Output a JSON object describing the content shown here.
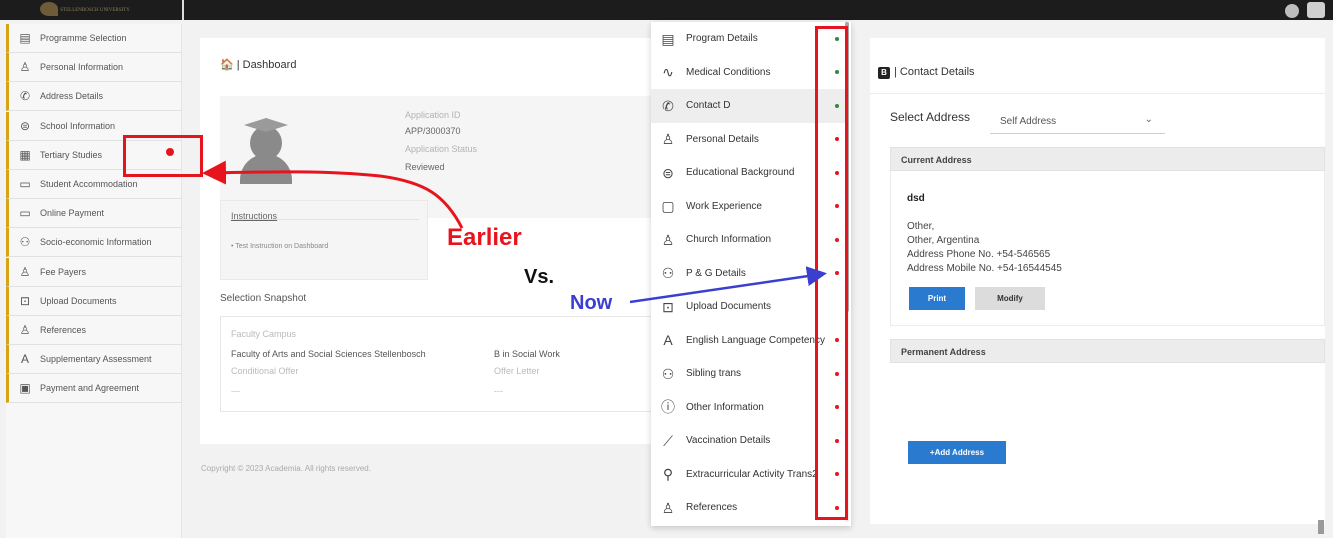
{
  "topbar": {
    "logo_text": "STELLENBOSCH UNIVERSITY"
  },
  "sidebar": {
    "items": [
      {
        "label": "Programme Selection",
        "icon": "document-icon"
      },
      {
        "label": "Personal Information",
        "icon": "person-list-icon"
      },
      {
        "label": "Address Details",
        "icon": "phone-icon"
      },
      {
        "label": "School Information",
        "icon": "graduation-cap-icon"
      },
      {
        "label": "Tertiary Studies",
        "icon": "building-icon"
      },
      {
        "label": "Student Accommodation",
        "icon": "bed-icon"
      },
      {
        "label": "Online Payment",
        "icon": "card-icon"
      },
      {
        "label": "Socio-economic Information",
        "icon": "people-icon"
      },
      {
        "label": "Fee Payers",
        "icon": "payer-icon"
      },
      {
        "label": "Upload Documents",
        "icon": "upload-folder-icon"
      },
      {
        "label": "References",
        "icon": "references-icon"
      },
      {
        "label": "Supplementary Assessment",
        "icon": "assessment-icon"
      },
      {
        "label": "Payment and Agreement",
        "icon": "agreement-icon"
      }
    ]
  },
  "dashboard": {
    "title": "Dashboard",
    "application_id_label": "Application ID",
    "application_id": "APP/3000370",
    "application_status_label": "Application Status",
    "application_status": "Reviewed",
    "instructions_title": "Instructions",
    "instruction_item": "Test Instruction on Dashboard",
    "snapshot_title": "Selection Snapshot",
    "faculty_campus_label": "Faculty Campus",
    "faculty_campus": "Faculty of Arts and Social Sciences Stellenbosch",
    "programme": "B in Social Work",
    "conditional_offer_label": "Conditional Offer",
    "conditional_offer": "---",
    "offer_letter_label": "Offer Letter",
    "offer_letter": "---",
    "copyright": "Copyright © 2023 Academia. All rights reserved."
  },
  "annotations": {
    "earlier": "Earlier",
    "vs": "Vs.",
    "now": "Now"
  },
  "menu": {
    "items": [
      {
        "label": "Program Details",
        "icon": "document-icon",
        "status": "green"
      },
      {
        "label": "Medical Conditions",
        "icon": "medical-icon",
        "status": "green"
      },
      {
        "label": "Contact D",
        "icon": "phone-icon",
        "status": "green",
        "active": true
      },
      {
        "label": "Personal Details",
        "icon": "person-list-icon",
        "status": "red"
      },
      {
        "label": "Educational Background",
        "icon": "graduation-cap-icon",
        "status": "red"
      },
      {
        "label": "Work Experience",
        "icon": "briefcase-icon",
        "status": "red"
      },
      {
        "label": "Church Information",
        "icon": "person-list-icon",
        "status": "red"
      },
      {
        "label": "P & G Details",
        "icon": "people-icon",
        "status": "red"
      },
      {
        "label": "Upload Documents",
        "icon": "upload-folder-icon",
        "status": "none"
      },
      {
        "label": "English Language Competency",
        "icon": "language-icon",
        "status": "red"
      },
      {
        "label": "Sibling trans",
        "icon": "siblings-icon",
        "status": "red"
      },
      {
        "label": "Other Information",
        "icon": "info-icon",
        "status": "red"
      },
      {
        "label": "Vaccination Details",
        "icon": "syringe-icon",
        "status": "red"
      },
      {
        "label": "Extracurricular Activity Trans2",
        "icon": "activity-icon",
        "status": "red"
      },
      {
        "label": "References",
        "icon": "references-icon",
        "status": "red"
      }
    ]
  },
  "contact": {
    "header": "Contact Details",
    "select_label": "Select Address",
    "select_value": "Self Address",
    "current_address_title": "Current Address",
    "name": "dsd",
    "line1": "Other,",
    "line2": "Other, Argentina",
    "phone": "Address Phone No. +54-546565",
    "mobile": "Address Mobile No. +54-16544545",
    "print_label": "Print",
    "modify_label": "Modify",
    "permanent_address_title": "Permanent Address",
    "add_address_label": "+Add Address"
  },
  "colors": {
    "accent_red": "#e8141d",
    "accent_blue": "#3a3fd0",
    "status_green": "#2e8b3e",
    "status_red": "#e8141d",
    "button_blue": "#2a7bcf",
    "sidebar_accent": "#d8a417"
  }
}
